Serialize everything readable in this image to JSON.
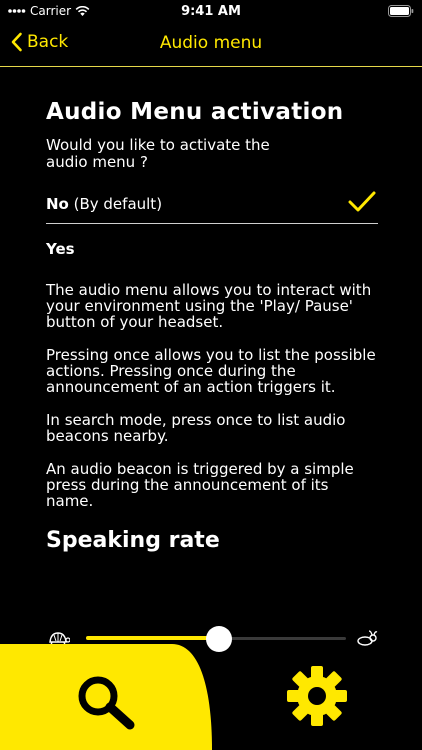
{
  "status_bar": {
    "carrier": "Carrier",
    "time": "9:41 AM"
  },
  "nav": {
    "back_label": "Back",
    "title": "Audio menu"
  },
  "section_activation": {
    "heading": "Audio Menu activation",
    "question": "Would you like to activate the audio menu ?",
    "option_no_bold": "No",
    "option_no_rest": " (By default)",
    "option_no_selected": true,
    "option_yes": "Yes"
  },
  "paragraphs": [
    "The audio menu allows you to interact with your environment using the 'Play/ Pause' button of your headset.",
    "Pressing once allows you to list the possible actions. Pressing once during the announcement of an action triggers it.",
    "In search mode, press once to list audio beacons nearby.",
    "An audio beacon is triggered by a simple press during the announcement of its name."
  ],
  "section_rate": {
    "heading": "Speaking rate",
    "slider_value": 0.51
  },
  "colors": {
    "accent": "#ffe800",
    "background": "#000000"
  },
  "tab_bar": {
    "left_icon": "search-icon",
    "right_icon": "gear-icon"
  }
}
